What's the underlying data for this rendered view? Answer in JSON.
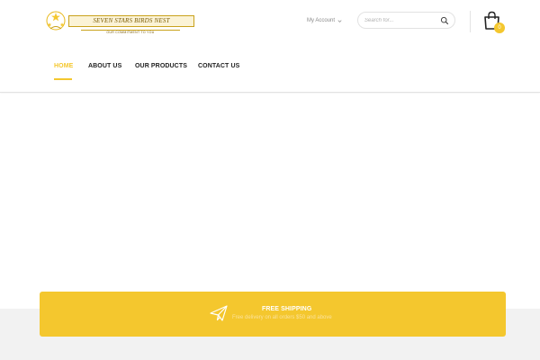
{
  "brand": {
    "name": "SEVEN STARS BIRDS NEST",
    "tagline": "OUR COMMITMENT TO YOU",
    "accent_color": "#f4c72e"
  },
  "header": {
    "account_label": "My Account",
    "search_placeholder": "Search for...",
    "cart_count": "0",
    "icons": [
      "chevron-down-icon",
      "search-icon",
      "shopping-bag-icon"
    ]
  },
  "nav": {
    "items": [
      {
        "label": "HOME",
        "active": true
      },
      {
        "label": "ABOUT US",
        "active": false
      },
      {
        "label": "OUR PRODUCTS",
        "active": false
      },
      {
        "label": "CONTACT US",
        "active": false
      }
    ]
  },
  "shipping_banner": {
    "title": "FREE SHIPPING",
    "subtitle": "Free delivery on all orders $50 and above",
    "icon": "paper-plane-icon",
    "background": "#f4c72e"
  }
}
